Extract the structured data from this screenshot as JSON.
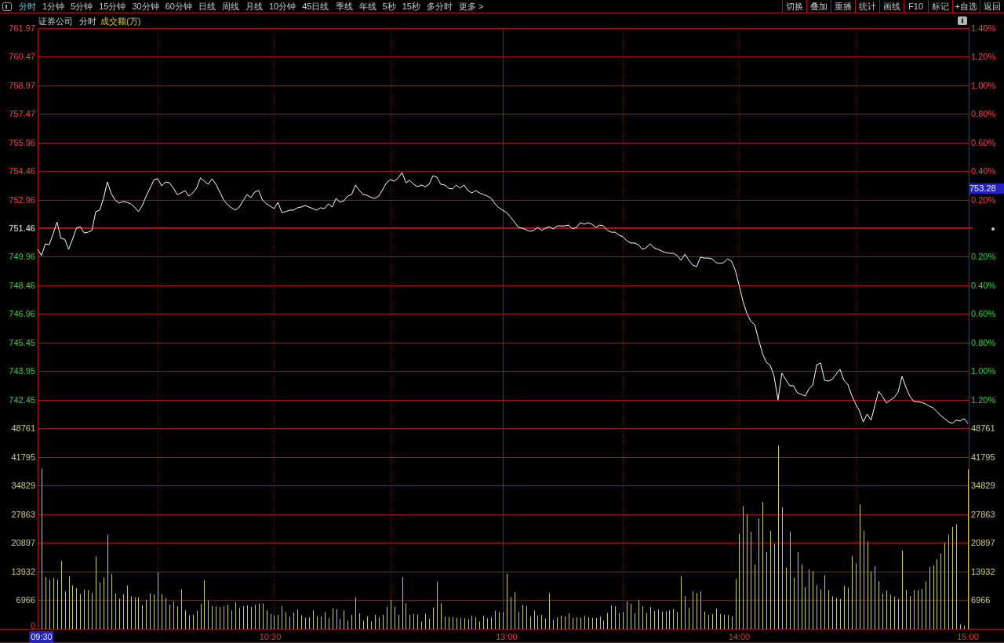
{
  "toolbar": {
    "tabs": [
      {
        "label": "分时",
        "selected": true
      },
      {
        "label": "1分钟",
        "selected": false
      },
      {
        "label": "5分钟",
        "selected": false
      },
      {
        "label": "15分钟",
        "selected": false
      },
      {
        "label": "30分钟",
        "selected": false
      },
      {
        "label": "60分钟",
        "selected": false
      },
      {
        "label": "日线",
        "selected": false
      },
      {
        "label": "周线",
        "selected": false
      },
      {
        "label": "月线",
        "selected": false
      },
      {
        "label": "10分钟",
        "selected": false
      },
      {
        "label": "45日线",
        "selected": false
      },
      {
        "label": "季线",
        "selected": false
      },
      {
        "label": "年线",
        "selected": false
      },
      {
        "label": "5秒",
        "selected": false
      },
      {
        "label": "15秒",
        "selected": false
      },
      {
        "label": "多分时",
        "selected": false
      },
      {
        "label": "更多 >",
        "selected": false
      }
    ],
    "buttons": [
      "切换",
      "叠加",
      "重播",
      "统计",
      "画线",
      "F10",
      "标记",
      "+自选",
      "返回"
    ]
  },
  "header": {
    "security": "证券公司",
    "period": "分时",
    "volume_label": "成交额(万)"
  },
  "chart": {
    "price_tag": "753.28",
    "first_time_label_highlighted": true,
    "chart_data": [
      {
        "type": "line",
        "values": [
          750.35,
          750.02,
          750.64,
          750.59,
          751.17,
          751.79,
          750.92,
          750.88,
          750.35,
          750.88,
          751.46,
          751.54,
          751.21,
          751.25,
          751.34,
          752.33,
          752.41,
          753.03,
          753.89,
          753.27,
          752.94,
          752.78,
          752.86,
          752.82,
          752.74,
          752.57,
          752.33,
          752.65,
          753.15,
          753.56,
          754.01,
          754.06,
          753.68,
          753.89,
          753.85,
          753.56,
          753.23,
          753.31,
          753.44,
          753.15,
          753.31,
          753.56,
          754.1,
          753.93,
          753.77,
          754.06,
          753.77,
          753.36,
          752.94,
          752.7,
          752.53,
          752.41,
          752.57,
          752.9,
          753.23,
          753.07,
          753.36,
          753.44,
          752.94,
          752.74,
          752.62,
          752.49,
          752.82,
          752.28,
          752.33,
          752.41,
          752.41,
          752.53,
          752.57,
          752.65,
          752.57,
          752.49,
          752.41,
          752.53,
          752.49,
          752.74,
          752.57,
          753.03,
          752.82,
          752.9,
          753.15,
          753.23,
          753.73,
          753.44,
          753.23,
          753.19,
          753.07,
          753.03,
          753.15,
          753.48,
          753.85,
          754.01,
          753.93,
          754.1,
          754.39,
          753.85,
          753.97,
          753.77,
          753.64,
          753.73,
          753.64,
          753.77,
          754.22,
          754.14,
          753.77,
          753.73,
          753.56,
          753.52,
          753.73,
          753.56,
          753.73,
          753.44,
          753.31,
          753.44,
          753.31,
          753.23,
          753.15,
          753.03,
          752.74,
          752.53,
          752.4,
          752.28,
          752.04,
          751.79,
          751.5,
          751.46,
          751.38,
          751.3,
          751.34,
          751.5,
          751.34,
          751.46,
          751.54,
          751.42,
          751.58,
          751.58,
          751.58,
          751.62,
          751.42,
          751.5,
          751.75,
          751.67,
          751.75,
          751.67,
          751.5,
          751.62,
          751.58,
          751.34,
          751.25,
          751.25,
          751.09,
          751.01,
          750.8,
          750.68,
          750.68,
          750.59,
          750.35,
          750.43,
          750.64,
          750.43,
          750.35,
          750.26,
          750.18,
          750.14,
          750.14,
          750.02,
          749.77,
          750.1,
          749.77,
          749.52,
          749.44,
          749.94,
          749.89,
          749.89,
          749.85,
          749.65,
          749.61,
          749.65,
          749.85,
          749.73,
          749.24,
          748.45,
          747.59,
          746.97,
          746.56,
          746.39,
          745.61,
          744.87,
          744.41,
          744.25,
          743.67,
          742.43,
          743.84,
          743.51,
          743.18,
          743.18,
          742.81,
          742.73,
          742.64,
          743.01,
          743.22,
          744.29,
          744.37,
          743.47,
          743.42,
          743.51,
          743.79,
          744.04,
          743.47,
          743.26,
          742.68,
          742.23,
          741.86,
          741.28,
          741.69,
          741.37,
          742.15,
          742.89,
          742.6,
          742.27,
          742.43,
          742.56,
          742.85,
          743.67,
          743.1,
          742.64,
          742.35,
          742.33,
          742.31,
          742.23,
          742.11,
          742.02,
          741.82,
          741.61,
          741.45,
          741.28,
          741.2,
          741.37,
          741.33,
          741.45,
          741.2
        ],
        "color": "#ffffff",
        "ylim": [
          740.95,
          761.97
        ],
        "yticks": [
          761.97,
          760.47,
          758.97,
          757.47,
          755.96,
          754.46,
          752.96,
          751.46,
          749.96,
          748.46,
          746.96,
          745.45,
          743.95,
          742.45
        ],
        "y2lim": [
          -1.4,
          1.4
        ],
        "y2ticks": [
          {
            "value": 1.4,
            "label": "1.40%"
          },
          {
            "value": 1.2,
            "label": "1.20%"
          },
          {
            "value": 1.0,
            "label": "1.00%"
          },
          {
            "value": 0.8,
            "label": "0.80%"
          },
          {
            "value": 0.6,
            "label": "0.60%"
          },
          {
            "value": 0.4,
            "label": "0.40%"
          },
          {
            "value": 0.2,
            "label": "0.20%"
          },
          {
            "value": -0.2,
            "label": "0.20%"
          },
          {
            "value": -0.4,
            "label": "0.40%"
          },
          {
            "value": -0.6,
            "label": "0.60%"
          },
          {
            "value": -0.8,
            "label": "0.80%"
          },
          {
            "value": -1.0,
            "label": "1.00%"
          },
          {
            "value": -1.2,
            "label": "1.20%"
          }
        ],
        "ref_lines": [
          {
            "axis": "y",
            "value": 751.46
          }
        ],
        "grid": true
      },
      {
        "type": "bar",
        "categories": [
          "09:30",
          null,
          null,
          null,
          null,
          null,
          null,
          null,
          null,
          null,
          null,
          null,
          null,
          null,
          null,
          null,
          null,
          null,
          null,
          null,
          null,
          null,
          null,
          null,
          null,
          null,
          null,
          null,
          null,
          null,
          null,
          null,
          null,
          null,
          null,
          null,
          null,
          null,
          null,
          null,
          null,
          null,
          null,
          null,
          null,
          null,
          null,
          null,
          null,
          null,
          null,
          null,
          null,
          null,
          null,
          null,
          null,
          null,
          null,
          "10:30",
          null,
          null,
          null,
          null,
          null,
          null,
          null,
          null,
          null,
          null,
          null,
          null,
          null,
          null,
          null,
          null,
          null,
          null,
          null,
          null,
          null,
          null,
          null,
          null,
          null,
          null,
          null,
          null,
          null,
          null,
          null,
          null,
          null,
          null,
          null,
          null,
          null,
          null,
          null,
          null,
          null,
          null,
          null,
          null,
          null,
          null,
          null,
          null,
          null,
          null,
          null,
          null,
          null,
          null,
          null,
          null,
          null,
          null,
          null,
          null,
          "13:00",
          null,
          null,
          null,
          null,
          null,
          null,
          null,
          null,
          null,
          null,
          null,
          null,
          null,
          null,
          null,
          null,
          null,
          null,
          null,
          null,
          null,
          null,
          null,
          null,
          null,
          null,
          null,
          null,
          null,
          null,
          null,
          null,
          null,
          null,
          null,
          null,
          null,
          null,
          null,
          null,
          null,
          null,
          null,
          null,
          null,
          null,
          null,
          null,
          null,
          null,
          null,
          null,
          null,
          null,
          null,
          null,
          null,
          null,
          null,
          "14:00",
          null,
          null,
          null,
          null,
          null,
          null,
          null,
          null,
          null,
          null,
          null,
          null,
          null,
          null,
          null,
          null,
          null,
          null,
          null,
          null,
          null,
          null,
          null,
          null,
          null,
          null,
          null,
          null,
          null,
          null,
          null,
          null,
          null,
          null,
          null,
          null,
          null,
          null,
          null,
          null,
          null,
          null,
          null,
          null,
          null,
          null,
          null,
          null,
          null,
          null,
          null,
          null,
          null,
          null,
          null,
          null,
          null,
          null,
          "15:00"
        ],
        "values": [
          38900,
          12600,
          11900,
          12400,
          12000,
          16500,
          9100,
          12800,
          10600,
          9900,
          8500,
          9600,
          9400,
          8700,
          17600,
          11300,
          12500,
          22900,
          13300,
          8600,
          7400,
          8400,
          10500,
          7900,
          7600,
          7700,
          5800,
          7000,
          8600,
          8400,
          13700,
          8400,
          7500,
          5900,
          6600,
          5500,
          9600,
          4500,
          3300,
          3500,
          4400,
          6100,
          11800,
          6900,
          5600,
          5500,
          5300,
          5500,
          5900,
          4500,
          6500,
          5100,
          5500,
          5700,
          5300,
          5900,
          6100,
          6200,
          4500,
          3600,
          3200,
          3400,
          5500,
          4100,
          3000,
          4000,
          4700,
          3300,
          2700,
          2800,
          4500,
          3000,
          3000,
          4100,
          2600,
          5000,
          4800,
          2400,
          4500,
          2000,
          3400,
          7700,
          3800,
          2000,
          3000,
          1800,
          3400,
          2800,
          3400,
          5400,
          7100,
          5400,
          3400,
          12600,
          6200,
          3400,
          3600,
          3500,
          1800,
          3700,
          2500,
          5200,
          11500,
          6200,
          2900,
          2900,
          2900,
          2700,
          2600,
          2600,
          2400,
          3200,
          2800,
          1800,
          3200,
          2600,
          2800,
          4400,
          4100,
          4000,
          13400,
          7700,
          8900,
          4100,
          5800,
          5500,
          3000,
          4500,
          3200,
          3400,
          2500,
          8700,
          2200,
          2800,
          3200,
          3000,
          3800,
          2700,
          2800,
          2700,
          3200,
          2800,
          2700,
          2700,
          3000,
          2000,
          3900,
          5700,
          5500,
          3900,
          4100,
          6700,
          6100,
          3800,
          7000,
          5500,
          3900,
          5300,
          4400,
          4700,
          4200,
          4300,
          4500,
          4800,
          4100,
          12800,
          8000,
          5100,
          9100,
          8700,
          9100,
          4200,
          3400,
          3600,
          5000,
          3600,
          3400,
          3400,
          3000,
          12100,
          23100,
          29800,
          27900,
          23600,
          15700,
          26800,
          30900,
          18700,
          23800,
          20600,
          44500,
          29500,
          14900,
          23600,
          12400,
          18700,
          15700,
          10100,
          14400,
          14000,
          10600,
          9600,
          13000,
          9400,
          7900,
          7500,
          7300,
          10500,
          10000,
          17700,
          15900,
          30200,
          23800,
          21200,
          14000,
          15200,
          11600,
          8600,
          9300,
          8300,
          7800,
          7300,
          19000,
          9500,
          8000,
          9500,
          9400,
          9700,
          11500,
          15100,
          15400,
          16900,
          18300,
          20900,
          22900,
          24800,
          25400,
          1100,
          800,
          38800
        ],
        "color": "#c8c864",
        "ylim": [
          0,
          48761
        ],
        "yticks": [
          48761,
          41795,
          34829,
          27863,
          20897,
          13932,
          6966,
          0
        ],
        "y2lim": [
          0,
          48761
        ],
        "y2ticks": [
          48761,
          41795,
          34829,
          27863,
          20897,
          13932,
          6966
        ],
        "grid": true
      }
    ]
  }
}
